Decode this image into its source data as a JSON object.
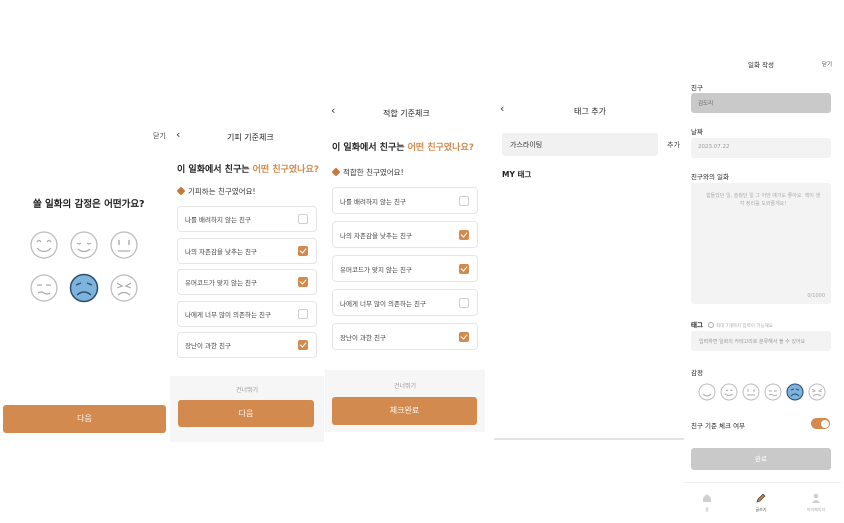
{
  "screen1": {
    "close_label": "닫기",
    "question": "쓸 일화의 감정은 어떤가요?",
    "next_label": "다음"
  },
  "screen2": {
    "back": "‹",
    "title": "기피 기준체크",
    "question_pre": "이 일화에서 친구는 ",
    "question_hl": "어떤 친구였나요?",
    "subtitle": "기피하는 친구였어요!",
    "items": [
      {
        "label": "나를 배려하지 않는 친구",
        "checked": false
      },
      {
        "label": "나의 자존감을 낮추는 친구",
        "checked": true
      },
      {
        "label": "유머코드가 맞지 않는 친구",
        "checked": true
      },
      {
        "label": "나에게 너무 많이 의존하는 친구",
        "checked": false
      },
      {
        "label": "장난이 과한 친구",
        "checked": true
      }
    ],
    "skip": "건너뛰기",
    "next_label": "다음"
  },
  "screen3": {
    "back": "‹",
    "title": "적합 기준체크",
    "question_pre": "이 일화에서 친구는 ",
    "question_hl": "어떤 친구였나요?",
    "subtitle": "적합한 친구였어요!",
    "items": [
      {
        "label": "나를 배려하지 않는 친구",
        "checked": false
      },
      {
        "label": "나의 자존감을 낮추는 친구",
        "checked": true
      },
      {
        "label": "유머코드가 맞지 않는 친구",
        "checked": true
      },
      {
        "label": "나에게 너무 많이 의존하는 친구",
        "checked": false
      },
      {
        "label": "장난이 과한 친구",
        "checked": true
      }
    ],
    "skip": "건너뛰기",
    "done_label": "체크완료"
  },
  "screen4": {
    "back": "‹",
    "title": "태그 추가",
    "input_value": "가스라이팅",
    "add_label": "추가",
    "my_tags_title": "MY 태그"
  },
  "screen5": {
    "title": "일화 작성",
    "close_label": "닫기",
    "friend_label": "친구",
    "friend_value": "김도리",
    "date_label": "날짜",
    "date_value": "2023.07.22",
    "story_label": "친구와의 일화",
    "story_placeholder": "힘들었던 일, 슬펐던 일 그 어떤 얘기도 좋아요. 핵이 생각 정리를 도와줄게요!",
    "counter": "0/1000",
    "tag_label": "태그",
    "tag_hint": "최대 7개까지 입력이 가능해요",
    "tag_placeholder": "입력하면 일화의 카테고리로 분류해서 볼 수 있어요",
    "emotion_label": "감정",
    "toggle_label": "친구 기준 체크 여부",
    "toggle_on": true,
    "submit_label": "완료",
    "nav": [
      "홈",
      "글쓰기",
      "마이페이지"
    ]
  },
  "colors": {
    "accent": "#d28a4f",
    "face_selected": "#7db3dc",
    "face_outline": "#bdbdbd"
  }
}
